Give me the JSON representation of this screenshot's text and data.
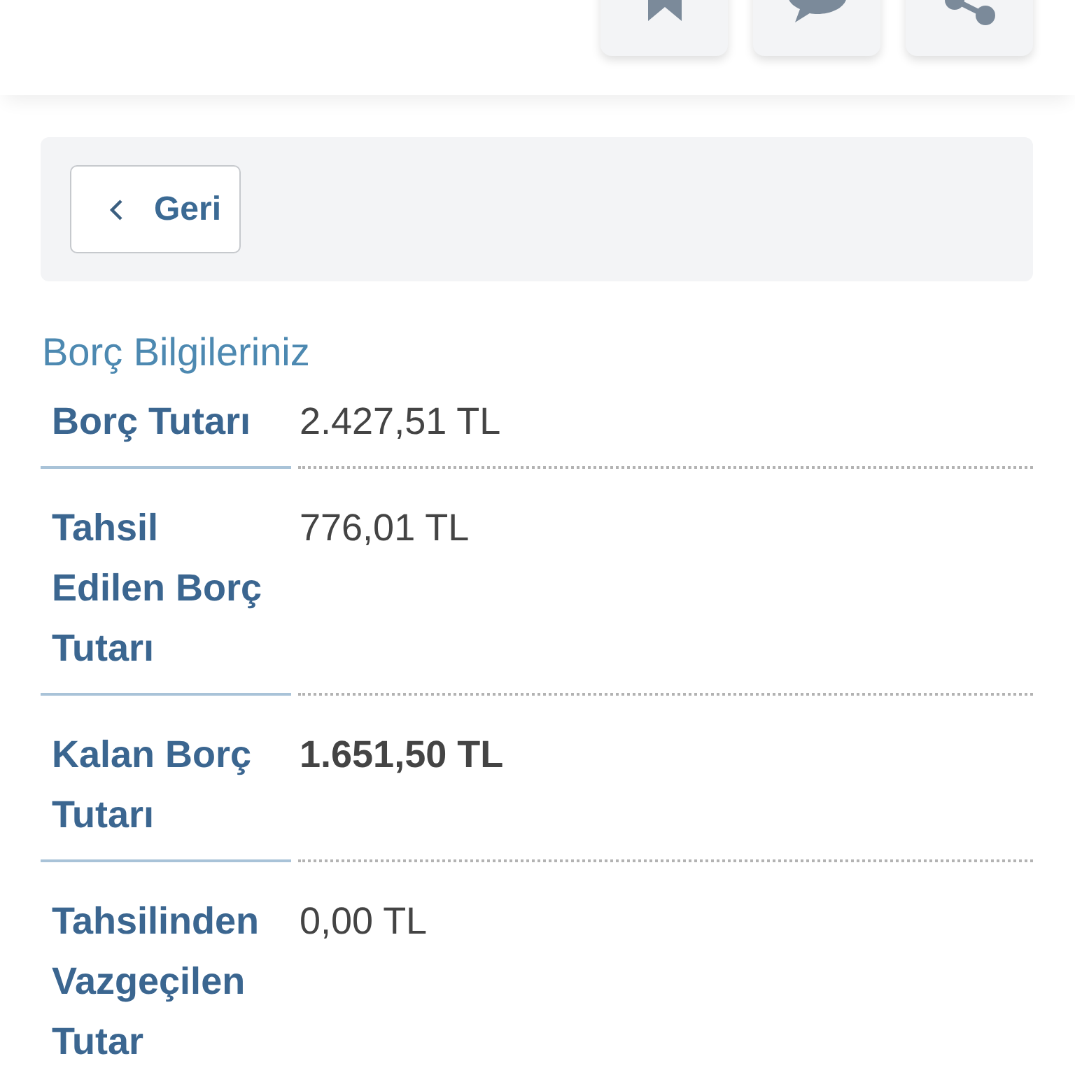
{
  "header": {
    "actions": [
      {
        "kind": "bookmark"
      },
      {
        "kind": "comment"
      },
      {
        "kind": "share"
      }
    ]
  },
  "toolbar": {
    "back_button": {
      "label": "Geri"
    }
  },
  "section": {
    "title": "Borç Bilgileriniz",
    "rows": [
      {
        "label": "Borç Tutarı",
        "value": "2.427,51 TL",
        "emphasized": false
      },
      {
        "label": "Tahsil Edilen Borç Tutarı",
        "value": "776,01 TL",
        "emphasized": false
      },
      {
        "label": "Kalan Borç Tutarı",
        "value": "1.651,50 TL",
        "emphasized": true
      },
      {
        "label": "Tahsilinden Vazgeçilen Tutar",
        "value": "0,00 TL",
        "emphasized": false
      }
    ]
  }
}
